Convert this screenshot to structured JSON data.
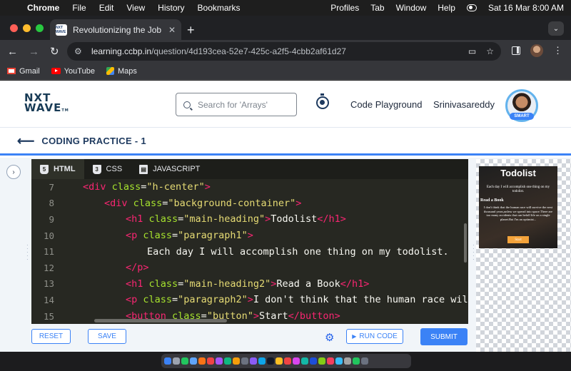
{
  "menubar": {
    "app": "Chrome",
    "items": [
      "File",
      "Edit",
      "View",
      "History",
      "Bookmarks"
    ],
    "right_items": [
      "Profiles",
      "Tab",
      "Window",
      "Help"
    ],
    "datetime": "Sat 16 Mar  8:00 AM"
  },
  "browser": {
    "tab_title": "Revolutionizing the Job Market",
    "tab_favicon_text": "NXT WAVE",
    "url_host": "learning.ccbp.in",
    "url_path": "/question/4d193cea-52e7-425c-a2f5-4cbb2af61d27",
    "bookmarks": [
      "Gmail",
      "YouTube",
      "Maps"
    ]
  },
  "site": {
    "logo_line1": "NXT",
    "logo_line2": "WAVE",
    "logo_tm": "TM",
    "search_placeholder": "Search for 'Arrays'",
    "code_playground": "Code Playground",
    "username": "Srinivasareddy",
    "avatar_badge": "SMART",
    "practice_title": "CODING PRACTICE - 1"
  },
  "editor": {
    "tabs": [
      {
        "label": "HTML",
        "icon": "html5-icon",
        "active": true
      },
      {
        "label": "CSS",
        "icon": "css3-icon",
        "active": false
      },
      {
        "label": "JAVASCRIPT",
        "icon": "javascript-icon",
        "active": false
      }
    ],
    "lines": [
      {
        "num": "7",
        "indent": 0,
        "tokens": [
          [
            "tag",
            "<div "
          ],
          [
            "attr",
            "class"
          ],
          [
            "txt",
            "="
          ],
          [
            "str",
            "\"h-center\""
          ],
          [
            "tag",
            ">"
          ]
        ]
      },
      {
        "num": "8",
        "indent": 1,
        "tokens": [
          [
            "tag",
            "<div "
          ],
          [
            "attr",
            "class"
          ],
          [
            "txt",
            "="
          ],
          [
            "str",
            "\"background-container\""
          ],
          [
            "tag",
            ">"
          ]
        ]
      },
      {
        "num": "9",
        "indent": 2,
        "tokens": [
          [
            "tag",
            "<h1 "
          ],
          [
            "attr",
            "class"
          ],
          [
            "txt",
            "="
          ],
          [
            "str",
            "\"main-heading\""
          ],
          [
            "tag",
            ">"
          ],
          [
            "txt",
            "Todolist"
          ],
          [
            "tag",
            "</h1>"
          ]
        ]
      },
      {
        "num": "10",
        "indent": 2,
        "tokens": [
          [
            "tag",
            "<p "
          ],
          [
            "attr",
            "class"
          ],
          [
            "txt",
            "="
          ],
          [
            "str",
            "\"paragraph1\""
          ],
          [
            "tag",
            ">"
          ]
        ]
      },
      {
        "num": "11",
        "indent": 3,
        "tokens": [
          [
            "txt",
            "Each day I will accomplish one thing on my todolist."
          ]
        ]
      },
      {
        "num": "12",
        "indent": 2,
        "tokens": [
          [
            "tag",
            "</p>"
          ]
        ]
      },
      {
        "num": "13",
        "indent": 2,
        "tokens": [
          [
            "tag",
            "<h1 "
          ],
          [
            "attr",
            "class"
          ],
          [
            "txt",
            "="
          ],
          [
            "str",
            "\"main-heading2\""
          ],
          [
            "tag",
            ">"
          ],
          [
            "txt",
            "Read a Book"
          ],
          [
            "tag",
            "</h1>"
          ]
        ]
      },
      {
        "num": "14",
        "indent": 2,
        "tokens": [
          [
            "tag",
            "<p "
          ],
          [
            "attr",
            "class"
          ],
          [
            "txt",
            "="
          ],
          [
            "str",
            "\"paragraph2\""
          ],
          [
            "tag",
            ">"
          ],
          [
            "txt",
            "I don't think that the human race will sur"
          ]
        ]
      },
      {
        "num": "15",
        "indent": 2,
        "tokens": [
          [
            "tag",
            "<button "
          ],
          [
            "attr",
            "class"
          ],
          [
            "txt",
            "="
          ],
          [
            "str",
            "\"button\""
          ],
          [
            "tag",
            ">"
          ],
          [
            "txt",
            "Start"
          ],
          [
            "tag",
            "</button>"
          ]
        ]
      }
    ]
  },
  "actions": {
    "reset": "RESET",
    "save": "SAVE",
    "run_code": "RUN CODE",
    "submit": "SUBMIT"
  },
  "preview": {
    "title": "Todolist",
    "paragraph1": "Each day I will accomplish one thing on my todolist.",
    "heading2": "Read a Book",
    "paragraph2": "I don't think that the human race will survive the next thousand years,unless we spread into space.There are too many accidents that can befall life on a single planet.But I'm an optimist...",
    "button": "Start"
  },
  "colors": {
    "accent": "#3b82f6",
    "editor_bg": "#272822",
    "navy": "#1e3a5f"
  }
}
